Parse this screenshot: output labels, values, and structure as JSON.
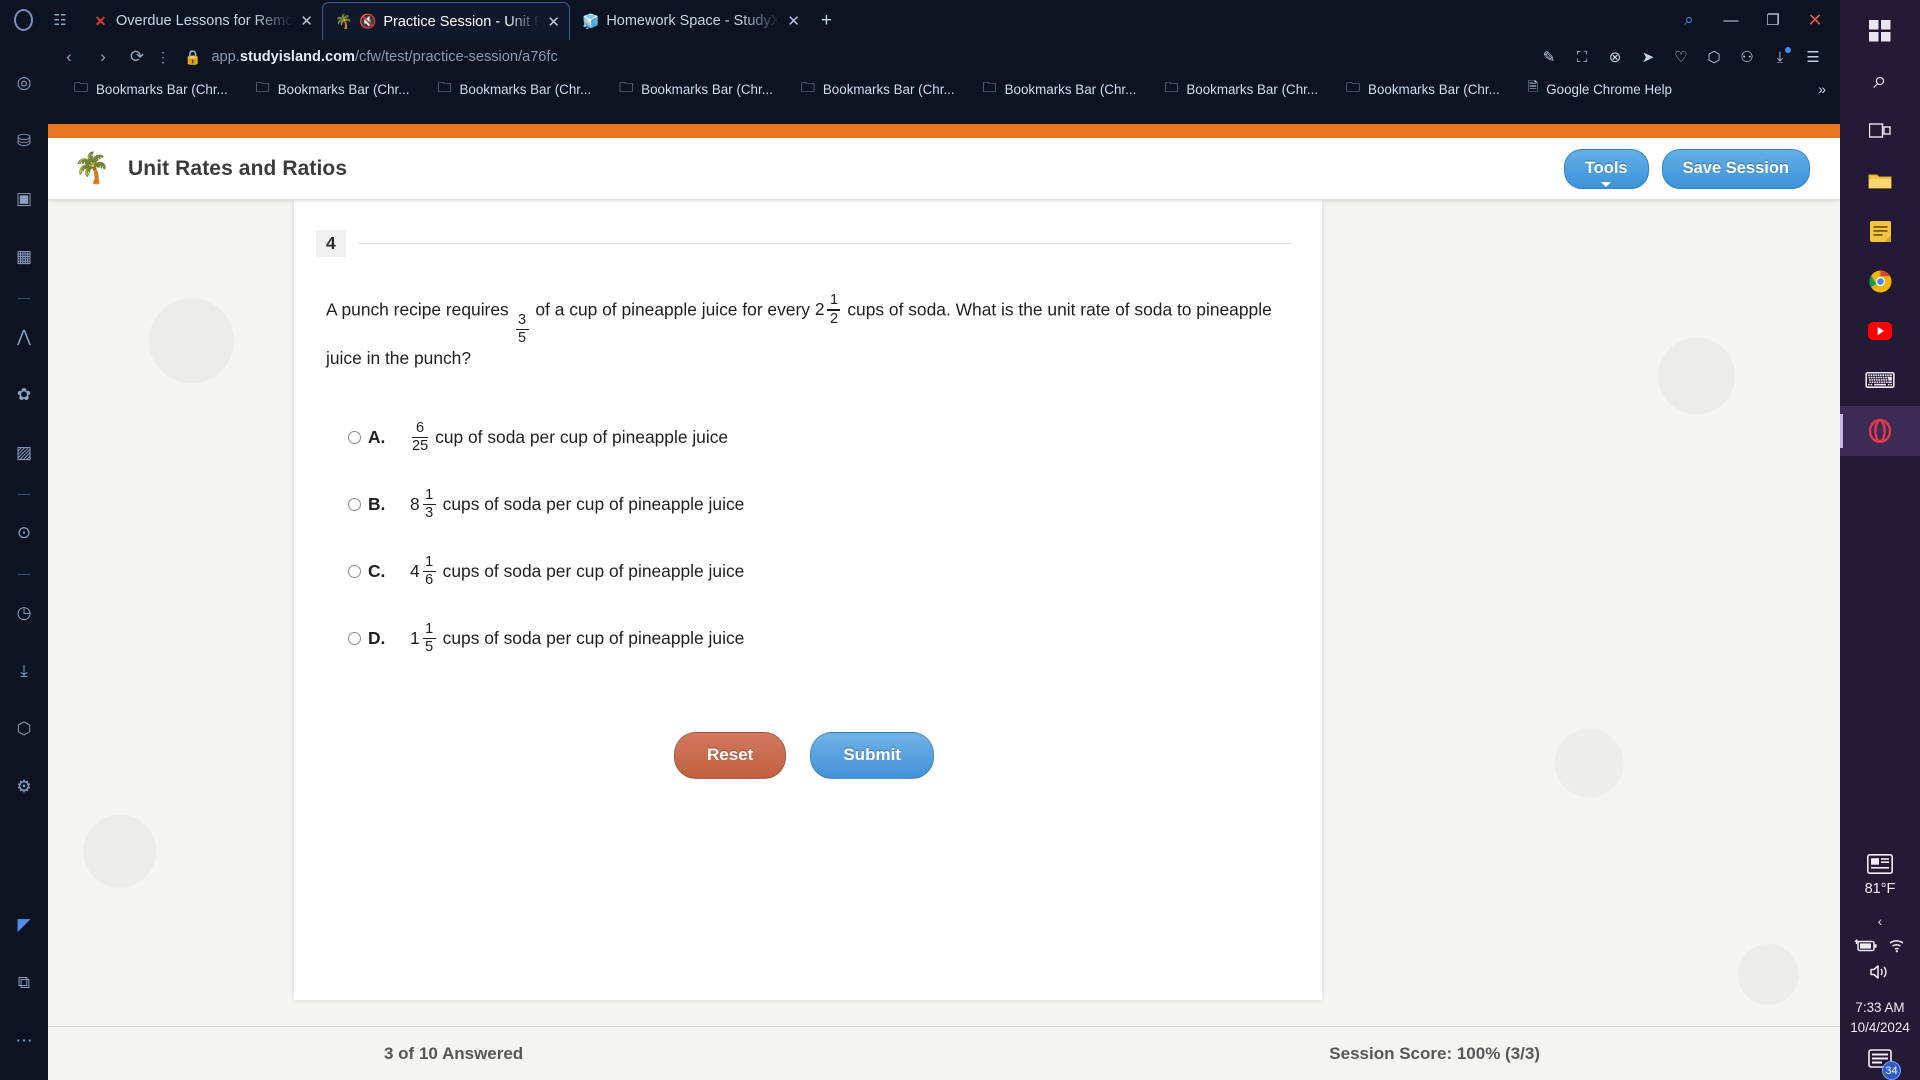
{
  "browser": {
    "name": "Opera",
    "tabs": [
      {
        "favicon": "x-icon",
        "title": "Overdue Lessons for Remo",
        "active": false
      },
      {
        "favicon": "palm-tree-icon",
        "title": "Practice Session - Unit R",
        "active": true,
        "muted": true
      },
      {
        "favicon": "cube-icon",
        "title": "Homework Space - StudyX",
        "active": false
      }
    ],
    "new_tab_label": "+",
    "window_controls": {
      "search": "⌕",
      "minimize": "—",
      "maximize": "❐",
      "close": "✕"
    },
    "address": {
      "back": "‹",
      "forward": "›",
      "reload": "⟳",
      "menu": "⋮",
      "lock": "lock-icon",
      "url_prefix": "app.",
      "url_domain": "studyisland.com",
      "url_path": "/cfw/test/practice-session/a76fc"
    },
    "addr_icons": [
      "edit-icon",
      "screenshot-icon",
      "block-ads-icon",
      "send-icon",
      "heart-icon",
      "cube-icon",
      "profile-icon",
      "download-icon",
      "sidebar-toggle-icon"
    ],
    "bookmarks": [
      "Bookmarks Bar (Chr...",
      "Bookmarks Bar (Chr...",
      "Bookmarks Bar (Chr...",
      "Bookmarks Bar (Chr...",
      "Bookmarks Bar (Chr...",
      "Bookmarks Bar (Chr...",
      "Bookmarks Bar (Chr...",
      "Bookmarks Bar (Chr...",
      "Google Chrome Help"
    ],
    "bookmarks_overflow": "»"
  },
  "site": {
    "logo": "palm-tree-icon",
    "title": "Unit Rates and Ratios",
    "tools_button": "Tools",
    "save_session_button": "Save Session"
  },
  "question": {
    "number": "4",
    "text_part1": "A punch recipe requires",
    "frac1": {
      "num": "3",
      "den": "5"
    },
    "text_part2": "of a cup of pineapple juice for every",
    "mixed1": {
      "whole": "2",
      "num": "1",
      "den": "2"
    },
    "text_part3": "cups of soda. What is the unit rate of soda to pineapple juice in the punch?",
    "choices": [
      {
        "letter": "A.",
        "kind": "fraction",
        "whole": "",
        "num": "6",
        "den": "25",
        "text": "cup of soda per cup of pineapple juice",
        "selected": false
      },
      {
        "letter": "B.",
        "kind": "mixed",
        "whole": "8",
        "num": "1",
        "den": "3",
        "text": "cups of soda per cup of pineapple juice",
        "selected": false
      },
      {
        "letter": "C.",
        "kind": "mixed",
        "whole": "4",
        "num": "1",
        "den": "6",
        "text": "cups of soda per cup of pineapple juice",
        "selected": false
      },
      {
        "letter": "D.",
        "kind": "mixed",
        "whole": "1",
        "num": "1",
        "den": "5",
        "text": "cups of soda per cup of pineapple juice",
        "selected": false
      }
    ],
    "reset_button": "Reset",
    "submit_button": "Submit"
  },
  "footer": {
    "progress": "3 of 10 Answered",
    "score": "Session Score: 100% (3/3)"
  },
  "taskbar": {
    "items": [
      {
        "name": "start-icon",
        "glyph": "⊞"
      },
      {
        "name": "search-icon",
        "glyph": "⌕"
      },
      {
        "name": "task-view-icon",
        "glyph": "❐"
      },
      {
        "name": "file-explorer-icon",
        "glyph": "🗂"
      },
      {
        "name": "sticky-notes-icon",
        "glyph": "🗒"
      },
      {
        "name": "chrome-icon",
        "glyph": "◉"
      },
      {
        "name": "youtube-icon",
        "glyph": "▶"
      },
      {
        "name": "keyboard-icon",
        "glyph": "⌨"
      },
      {
        "name": "opera-icon",
        "glyph": "◯"
      }
    ],
    "tray": {
      "weather_icon": "news-weather-icon",
      "temperature": "81°F",
      "show_hidden": "‹",
      "battery_icon": "battery-charging-icon",
      "wifi_icon": "wifi-icon",
      "volume_icon": "volume-icon",
      "time": "7:33 AM",
      "date": "10/4/2024",
      "notifications_icon": "notifications-icon",
      "notification_count": "34"
    }
  },
  "opera_sidebar": {
    "items": [
      "compass-icon",
      "bag-icon",
      "twitch-icon",
      "chip-icon",
      "divider",
      "aria-icon",
      "pinboard-icon",
      "instagram-icon",
      "divider",
      "player-icon",
      "divider",
      "history-icon",
      "downloads-icon",
      "cube-icon",
      "settings-icon"
    ],
    "bottom_items": [
      "workspace-icon",
      "extensions-icon",
      "more-icon"
    ]
  },
  "colors": {
    "brand_orange": "#e87722",
    "button_blue": "#4391d6",
    "reset_red": "#c0603f",
    "taskbar_purple": "#241a35",
    "browser_dark": "#0d1320"
  }
}
